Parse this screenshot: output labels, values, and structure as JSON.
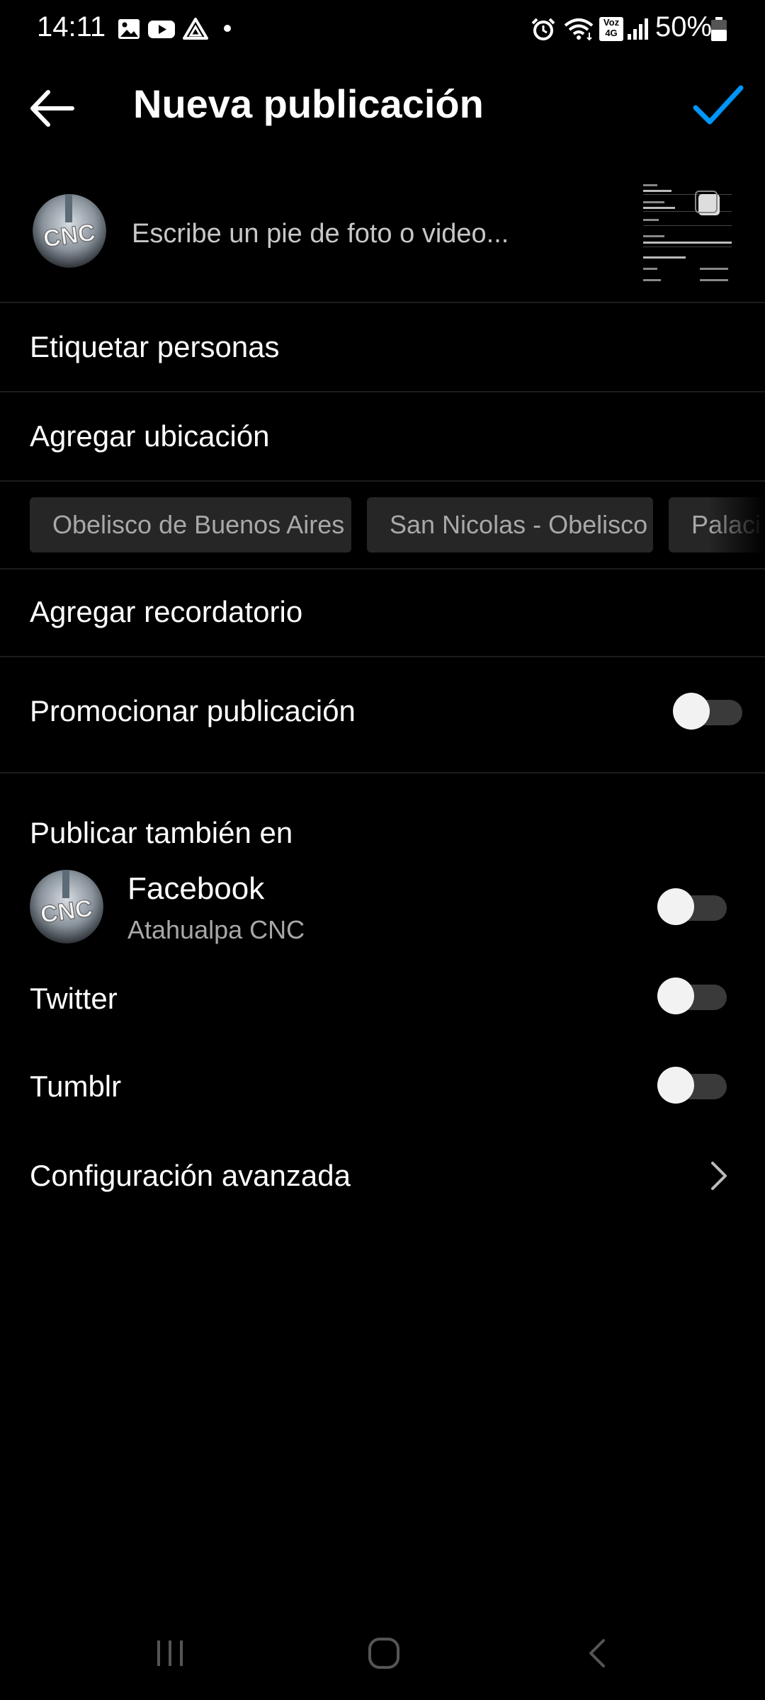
{
  "status_bar": {
    "time": "14:11",
    "battery": "50%",
    "left_icons": [
      "gallery-icon",
      "youtube-icon",
      "drive-icon",
      "dot-icon"
    ],
    "right_icons": [
      "alarm-icon",
      "wifi-icon",
      "volte-4g-icon",
      "signal-icon",
      "battery-icon"
    ],
    "volte_text_top": "Voz",
    "volte_text_bottom": "4G"
  },
  "header": {
    "title": "Nueva publicación",
    "accent_color": "#0095f6"
  },
  "caption": {
    "placeholder": "Escribe un pie de foto o video..."
  },
  "menu": {
    "tag_people": "Etiquetar personas",
    "add_location": "Agregar ubicación",
    "add_reminder": "Agregar recordatorio",
    "promote": "Promocionar publicación",
    "advanced": "Configuración avanzada"
  },
  "location_suggestions": [
    "Obelisco de Buenos Aires",
    "San Nicolas - Obelisco",
    "Palaci"
  ],
  "share_section": {
    "title": "Publicar también en",
    "facebook": {
      "name": "Facebook",
      "account": "Atahualpa CNC",
      "enabled": false
    },
    "twitter": {
      "name": "Twitter",
      "enabled": false
    },
    "tumblr": {
      "name": "Tumblr",
      "enabled": false
    }
  },
  "promote_enabled": false,
  "nav_bar": [
    "recent-apps-icon",
    "home-icon",
    "back-nav-icon"
  ]
}
